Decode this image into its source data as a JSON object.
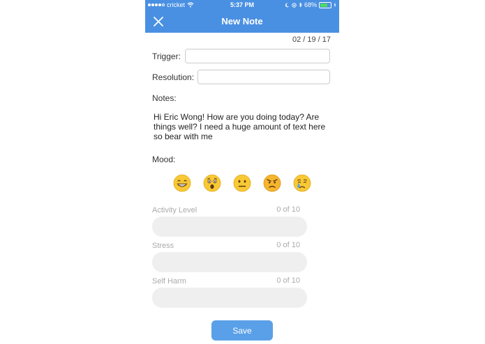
{
  "status_bar": {
    "carrier": "cricket",
    "time": "5:37 PM",
    "battery": "68%",
    "battery_level": 0.68
  },
  "header": {
    "title": "New Note"
  },
  "date": "02 / 19 / 17",
  "form": {
    "trigger_label": "Trigger:",
    "trigger_value": "",
    "resolution_label": "Resolution:",
    "resolution_value": "",
    "notes_label": "Notes:",
    "notes_text": "Hi Eric Wong!  How are you doing today?  Are things well?  I need a huge amount of text here so bear with me",
    "mood_label": "Mood:",
    "moods": [
      "grinning-face-icon",
      "astonished-face-icon",
      "neutral-face-icon",
      "angry-face-icon",
      "crying-face-icon"
    ]
  },
  "sliders": [
    {
      "label": "Activity Level",
      "count_text": "0 of 10",
      "value": 0,
      "max": 10
    },
    {
      "label": "Stress",
      "count_text": "0 of 10",
      "value": 0,
      "max": 10
    },
    {
      "label": "Self Harm",
      "count_text": "0 of 10",
      "value": 0,
      "max": 10
    }
  ],
  "save_label": "Save",
  "colors": {
    "accent": "#4a90e2",
    "battery": "#4cd964"
  }
}
